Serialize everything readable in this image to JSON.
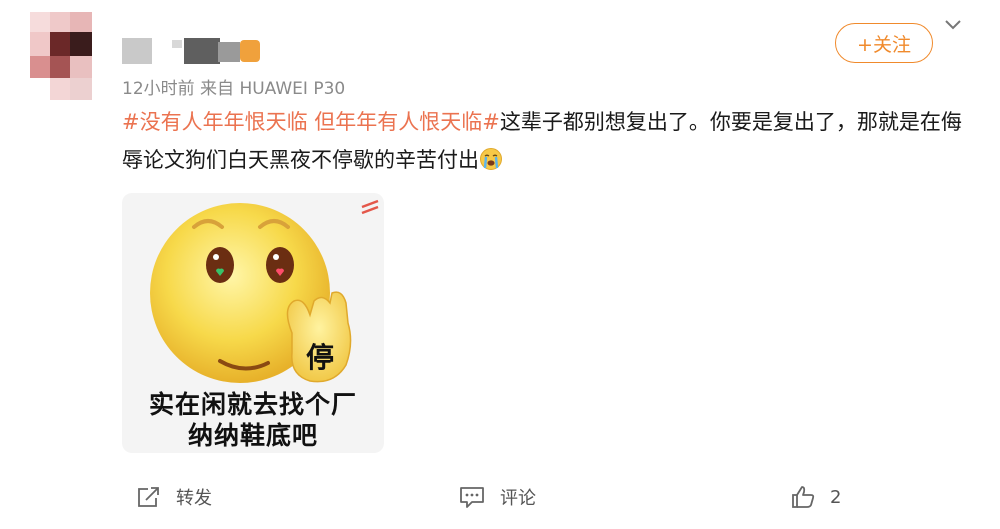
{
  "post": {
    "meta": "12小时前  来自 HUAWEI P30",
    "follow_label": "+关注",
    "content": {
      "topic1": "#没有人年年恨天临",
      "topic2": "但年年有人恨天临#",
      "text": "这辈子都别想复出了。你要是复出了，那就是在侮辱论文狗们白天黑夜不停歇的辛苦付出",
      "emoji": "crying-face-icon"
    },
    "image": {
      "stop_text": "停",
      "caption_line1": "实在闲就去找个厂",
      "caption_line2": "纳纳鞋底吧"
    }
  },
  "actions": {
    "repost_label": "转发",
    "comment_label": "评论",
    "like_count": "2"
  },
  "colors": {
    "accent": "#f08a2c",
    "topic": "#eb7350",
    "meta": "#8a8a8a"
  }
}
